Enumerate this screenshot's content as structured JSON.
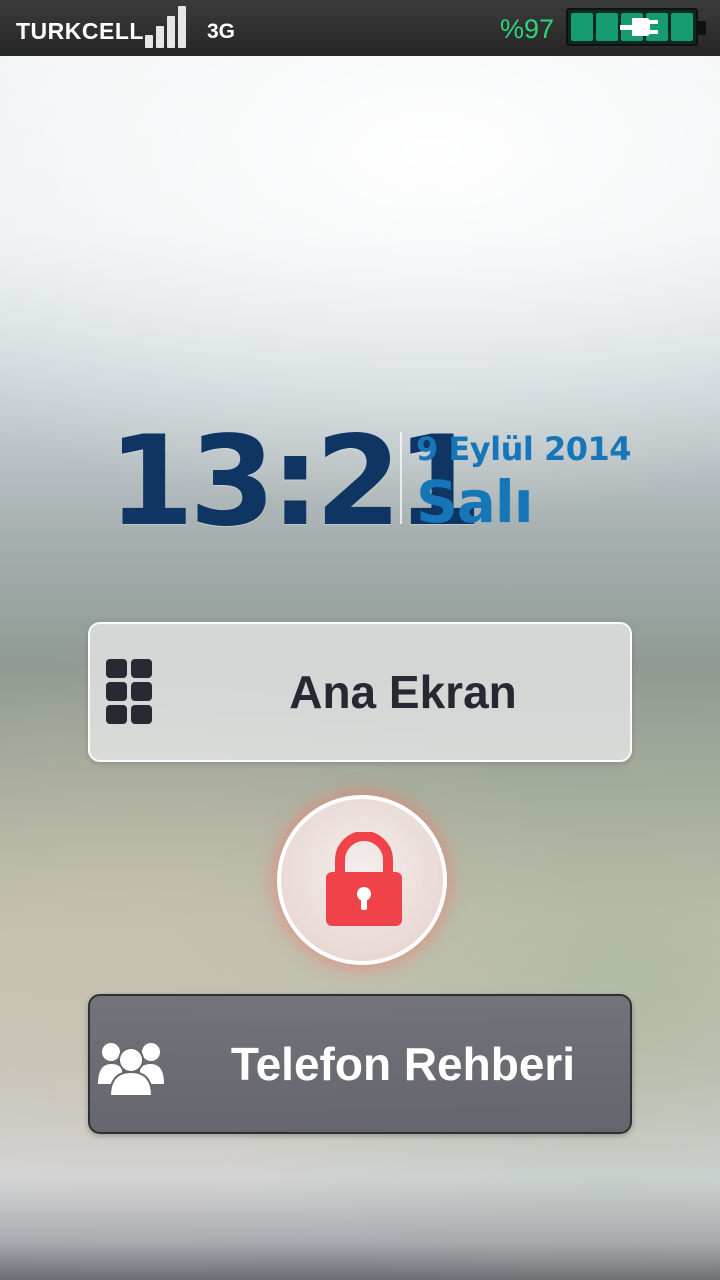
{
  "status_bar": {
    "carrier": "TURKCELL",
    "network": "3G",
    "battery_percent": "%97",
    "signal_level": 4
  },
  "clock": {
    "time": "13:21",
    "date": "9 Eylül 2014",
    "day": "Salı"
  },
  "buttons": {
    "home_label": "Ana Ekran",
    "contacts_label": "Telefon Rehberi"
  },
  "icons": {
    "signal": "signal-icon",
    "battery": "battery-icon",
    "charging": "plug-icon",
    "home": "grid-icon",
    "contacts": "people-icon",
    "lock": "lock-icon"
  },
  "colors": {
    "clock": "#0f3563",
    "date": "#1676b8",
    "battery_text": "#2bd67a",
    "lock": "#ef4249"
  }
}
